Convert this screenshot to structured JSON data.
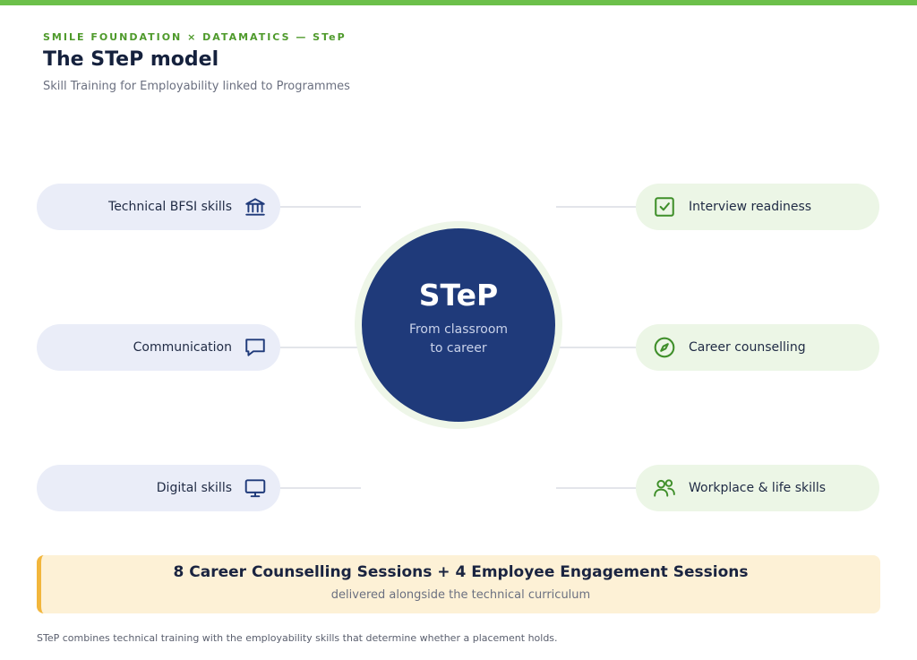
{
  "header": {
    "eyebrow": "SMILE FOUNDATION × DATAMATICS — STeP",
    "title": "The STeP model",
    "subtitle": "Skill Training for Employability linked to Programmes"
  },
  "center": {
    "title": "STeP",
    "tagline_line1": "From classroom",
    "tagline_line2": "to career",
    "color": "#1f3a7a"
  },
  "left_items": [
    {
      "label": "Technical BFSI skills",
      "icon": "bank-icon"
    },
    {
      "label": "Communication",
      "icon": "chat-icon"
    },
    {
      "label": "Digital skills",
      "icon": "monitor-icon"
    }
  ],
  "right_items": [
    {
      "label": "Interview readiness",
      "icon": "checkbox-icon"
    },
    {
      "label": "Career counselling",
      "icon": "compass-icon"
    },
    {
      "label": "Workplace & life skills",
      "icon": "people-icon"
    }
  ],
  "banner": {
    "main": "8 Career Counselling Sessions + 4 Employee Engagement Sessions",
    "sub": "delivered alongside the technical curriculum"
  },
  "footnote": "STeP combines technical training with the employability skills that determine whether a placement holds.",
  "colors": {
    "accent_green": "#6cc04a",
    "navy": "#1f3a7a",
    "left_pill": "#eaedf8",
    "right_pill": "#ecf6e6",
    "banner_bg": "#fdf1d6",
    "banner_bar": "#f2b63c"
  }
}
